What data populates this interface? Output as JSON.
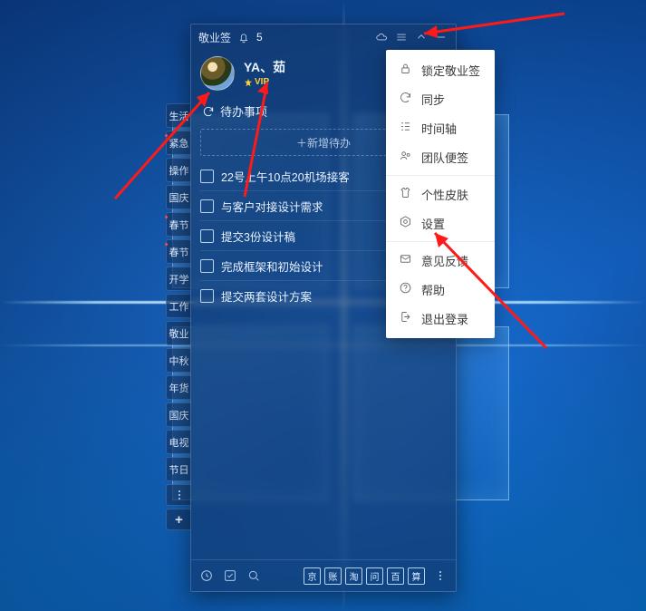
{
  "titlebar": {
    "app_name": "敬业签",
    "notif_count": "5"
  },
  "user": {
    "name": "YA、茹",
    "vip": "VIP"
  },
  "section": {
    "title": "待办事项",
    "add_placeholder": "＋新增待办"
  },
  "tasks": [
    {
      "text": "22号上午10点20机场接客"
    },
    {
      "text": "与客户对接设计需求"
    },
    {
      "text": "提交3份设计稿"
    },
    {
      "text": "完成框架和初始设计"
    },
    {
      "text": "提交两套设计方案"
    }
  ],
  "side_tags": [
    {
      "label": "生活"
    },
    {
      "label": "紧急"
    },
    {
      "label": "操作"
    },
    {
      "label": "国庆"
    },
    {
      "label": "春节"
    },
    {
      "label": "春节"
    },
    {
      "label": "开学"
    },
    {
      "label": "工作"
    },
    {
      "label": "敬业"
    },
    {
      "label": "中秋"
    },
    {
      "label": "年货"
    },
    {
      "label": "国庆"
    },
    {
      "label": "电视"
    },
    {
      "label": "节日"
    }
  ],
  "menu": [
    {
      "label": "锁定敬业签",
      "icon": "lock"
    },
    {
      "label": "同步",
      "icon": "sync"
    },
    {
      "label": "时间轴",
      "icon": "timeline"
    },
    {
      "label": "团队便签",
      "icon": "team"
    },
    {
      "sep": true
    },
    {
      "label": "个性皮肤",
      "icon": "skin"
    },
    {
      "label": "设置",
      "icon": "settings"
    },
    {
      "sep": true
    },
    {
      "label": "意见反馈",
      "icon": "mail"
    },
    {
      "label": "帮助",
      "icon": "help"
    },
    {
      "label": "退出登录",
      "icon": "logout"
    }
  ],
  "bottom": {
    "chars": [
      "京",
      "账",
      "淘",
      "问",
      "百",
      "算"
    ]
  }
}
